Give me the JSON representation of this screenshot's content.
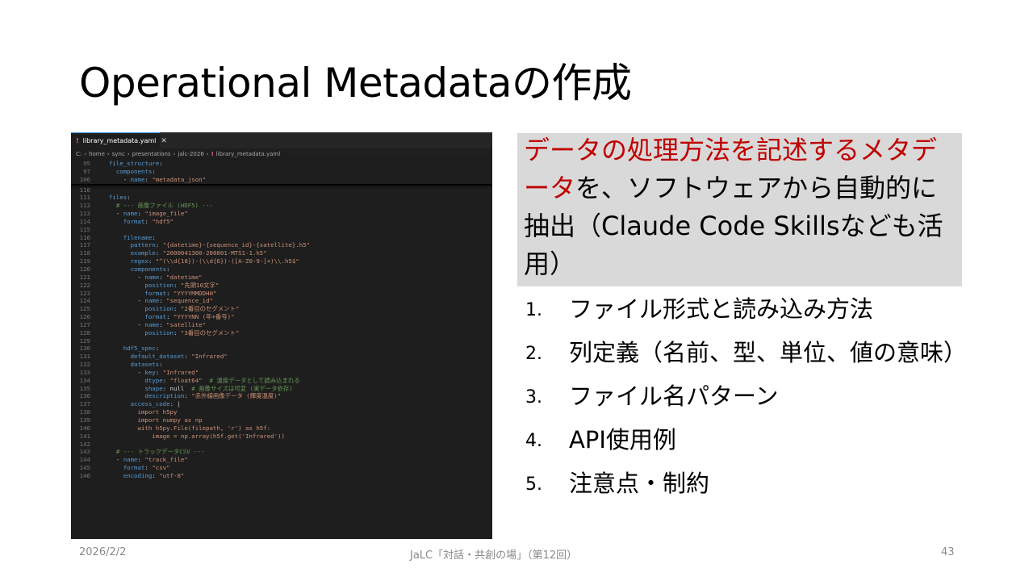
{
  "slide": {
    "title": "Operational Metadataの作成",
    "highlight": {
      "red1": "データの処理方法を記述するメタデータ",
      "black1": "を、ソフトウェアから自動的に抽出（Claude Code Skillsなども活用）"
    },
    "items": [
      {
        "num": "1.",
        "text": "ファイル形式と読み込み方法"
      },
      {
        "num": "2.",
        "text": "列定義（名前、型、単位、値の意味）"
      },
      {
        "num": "3.",
        "text": "ファイル名パターン"
      },
      {
        "num": "4.",
        "text": "API使用例"
      },
      {
        "num": "5.",
        "text": "注意点・制約"
      }
    ],
    "footer": {
      "date": "2026/2/2",
      "center": "JaLC「対話・共創の場」（第12回）",
      "page": "43"
    }
  },
  "editor": {
    "tab_label": "library_metadata.yaml",
    "tab_icon": "!",
    "close": "✕",
    "breadcrumbs": [
      "C:",
      "home",
      "sync",
      "presentations",
      "jalc-2026",
      "library_metadata.yaml"
    ],
    "sticky_lines": [
      {
        "n": "95",
        "t": "  file_structure:"
      },
      {
        "n": "97",
        "t": "    components:"
      },
      {
        "n": "106",
        "t": "      - name: \"metadata_json\""
      }
    ],
    "lines": [
      {
        "n": "110",
        "t": ""
      },
      {
        "n": "111",
        "t": "  files:"
      },
      {
        "n": "112",
        "t": "    # --- 画像ファイル (HDF5) ---"
      },
      {
        "n": "113",
        "t": "    - name: \"image_file\""
      },
      {
        "n": "114",
        "t": "      format: \"hdf5\""
      },
      {
        "n": "115",
        "t": ""
      },
      {
        "n": "116",
        "t": "      filename:"
      },
      {
        "n": "117",
        "t": "        pattern: \"{datetime}-{sequence_id}-{satellite}.h5\""
      },
      {
        "n": "118",
        "t": "        example: \"2000041300-200001-MTS1-1.h5\""
      },
      {
        "n": "119",
        "t": "        regex: \"^(\\\\d{10})-(\\\\d{6})-([A-Z0-9-]+)\\\\.h5$\""
      },
      {
        "n": "120",
        "t": "        components:"
      },
      {
        "n": "121",
        "t": "          - name: \"datetime\""
      },
      {
        "n": "122",
        "t": "            position: \"先頭10文字\""
      },
      {
        "n": "123",
        "t": "            format: \"YYYYMMDDHH\""
      },
      {
        "n": "124",
        "t": "          - name: \"sequence_id\""
      },
      {
        "n": "125",
        "t": "            position: \"2番目のセグメント\""
      },
      {
        "n": "126",
        "t": "            format: \"YYYYNN (年+番号)\""
      },
      {
        "n": "127",
        "t": "          - name: \"satellite\""
      },
      {
        "n": "128",
        "t": "            position: \"3番目のセグメント\""
      },
      {
        "n": "129",
        "t": ""
      },
      {
        "n": "130",
        "t": "      hdf5_spec:"
      },
      {
        "n": "131",
        "t": "        default_dataset: \"Infrared\""
      },
      {
        "n": "132",
        "t": "        datasets:"
      },
      {
        "n": "133",
        "t": "          - key: \"Infrared\""
      },
      {
        "n": "134",
        "t": "            dtype: \"float64\"  # 温度データとして読み込まれる"
      },
      {
        "n": "135",
        "t": "            shape: null  # 画像サイズは可変 (実データ依存)"
      },
      {
        "n": "136",
        "t": "            description: \"赤外線画像データ (輝度温度)\""
      },
      {
        "n": "137",
        "t": "        access_code: |"
      },
      {
        "n": "138",
        "t": "          import h5py"
      },
      {
        "n": "139",
        "t": "          import numpy as np"
      },
      {
        "n": "140",
        "t": "          with h5py.File(filepath, 'r') as h5f:"
      },
      {
        "n": "141",
        "t": "              image = np.array(h5f.get('Infrared'))"
      },
      {
        "n": "142",
        "t": ""
      },
      {
        "n": "143",
        "t": "    # --- トラックデータCSV ---"
      },
      {
        "n": "144",
        "t": "    - name: \"track_file\""
      },
      {
        "n": "145",
        "t": "      format: \"csv\""
      },
      {
        "n": "146",
        "t": "      encoding: \"utf-8\""
      }
    ]
  }
}
